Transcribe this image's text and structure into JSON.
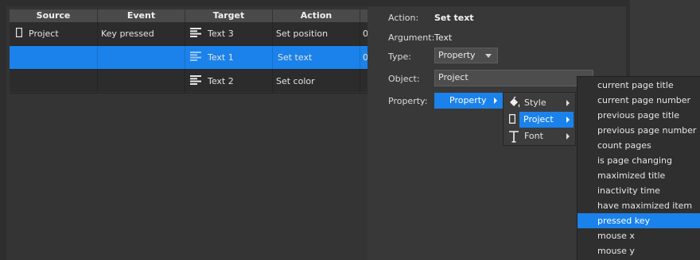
{
  "table": {
    "headers": [
      "Source",
      "Event",
      "Target",
      "Action"
    ],
    "rows": [
      {
        "source": "Project",
        "event": "Key pressed",
        "target": "Text 3",
        "action": "Set position",
        "extra": "0"
      },
      {
        "source": "",
        "event": "",
        "target": "Text 1",
        "action": "Set text",
        "extra": "0"
      },
      {
        "source": "",
        "event": "",
        "target": "Text 2",
        "action": "Set color",
        "extra": ""
      }
    ]
  },
  "props": {
    "action_label": "Action:",
    "action_value": "Set text",
    "argument_label": "Argument:",
    "argument_value": "Text",
    "type_label": "Type:",
    "type_value": "Property",
    "object_label": "Object:",
    "object_value": "Project",
    "property_label": "Property:",
    "property_value": "Property"
  },
  "menu1": {
    "items": [
      {
        "label": "Style",
        "icon": "paint-bucket-icon"
      },
      {
        "label": "Project",
        "icon": "page-icon"
      },
      {
        "label": "Font",
        "icon": "font-T-icon"
      }
    ],
    "selected": "Project"
  },
  "menu2": {
    "items": [
      "current page title",
      "current page number",
      "previous page title",
      "previous page number",
      "count pages",
      "is page changing",
      "maximized title",
      "inactivity time",
      "have maximized item",
      "pressed key",
      "mouse x",
      "mouse y"
    ],
    "selected": "pressed key"
  },
  "colors": {
    "accent": "#1a82ea",
    "panel": "#383838",
    "table_bg": "#2c2c2c",
    "header_bg": "#4a4a4a"
  }
}
